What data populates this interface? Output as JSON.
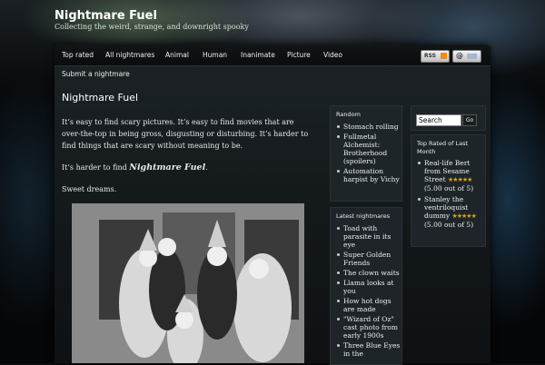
{
  "site": {
    "title": "Nightmare Fuel",
    "tagline": "Collecting the weird, strange, and downright spooky"
  },
  "nav": {
    "items": [
      "Top rated",
      "All nightmares",
      "Animal",
      "Human",
      "Inanimate",
      "Picture",
      "Video"
    ],
    "rss_label": "RSS",
    "email_icon": "at-sign-icon",
    "submit_link": "Submit a nightmare"
  },
  "main": {
    "title": "Nightmare Fuel",
    "paragraph1": "It’s easy to find scary pictures. It’s easy to find movies that are over-the-top in being gross, disgusting or disturbing. It’s harder to find things that are scary without meaning to be.",
    "paragraph2_prefix": "It’s harder to find ",
    "paragraph2_emphasis": "Nightmare Fuel",
    "paragraph2_suffix": ".",
    "paragraph3": "Sweet dreams."
  },
  "sidebar_left": {
    "random": {
      "title": "Random",
      "items": [
        "Stomach rolling",
        "Fullmetal Alchemist: Brotherhood (spoilers)",
        "Automation harpist by Vichy"
      ]
    },
    "latest": {
      "title": "Latest nightmares",
      "items": [
        "Toad with parasite in its eye",
        "Super Golden Friends",
        "The clown waits",
        "Llama looks at you",
        "How hot dogs are made",
        "\"Wizard of Oz\" cast photo from early 1900s",
        "Three Blue Eyes in the"
      ]
    }
  },
  "sidebar_right": {
    "search": {
      "value": "Search",
      "button": "Go"
    },
    "top_rated": {
      "title": "Top Rated of Last Month",
      "items": [
        {
          "name": "Real-life Bert from Sesame Street",
          "rating": "(5.00 out of 5)",
          "stars": "★★★★★"
        },
        {
          "name": "Stanley the ventriloquist dummy",
          "rating": "(5.00 out of 5)",
          "stars": "★★★★★"
        }
      ]
    }
  },
  "colors": {
    "accent_star": "#d9a21b",
    "background": "#0a0c0e"
  }
}
